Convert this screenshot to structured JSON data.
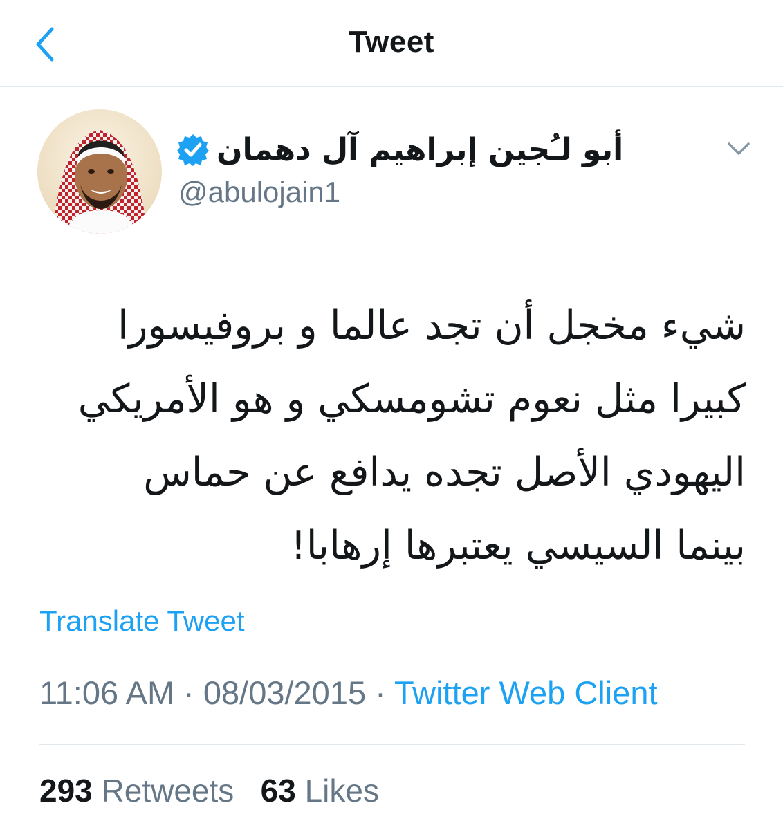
{
  "header": {
    "title": "Tweet",
    "back_icon": "chevron-left-icon"
  },
  "author": {
    "display_name": "أبو لـُجين إبراهيم آل دهمان",
    "handle": "@abulojain1",
    "verified_icon": "verified-badge-icon",
    "caret_icon": "chevron-down-icon"
  },
  "tweet": {
    "lines": [
      "شيء مخجل أن تجد عالما و بروفيسورا",
      "كبيرا مثل نعوم تشومسكي و هو الأمريكي",
      "اليهودي الأصل تجده يدافع عن حماس",
      "بينما السيسي يعتبرها إرهابا!"
    ],
    "translate_label": "Translate Tweet",
    "time": "11:06 AM",
    "date": "08/03/2015",
    "source": "Twitter Web Client",
    "separator": "·"
  },
  "stats": {
    "retweets_count": "293",
    "retweets_label": "Retweets",
    "likes_count": "63",
    "likes_label": "Likes"
  },
  "colors": {
    "accent": "#1da1f2",
    "secondary_text": "#657786",
    "primary_text": "#14171a",
    "divider": "#e1e8ed"
  }
}
